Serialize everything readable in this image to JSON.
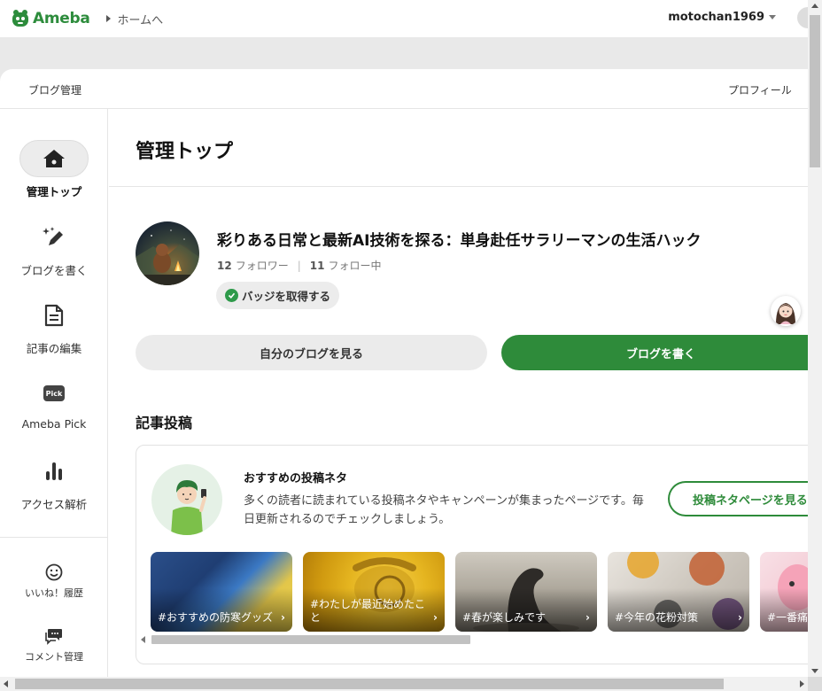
{
  "header": {
    "logo_text": "Ameba",
    "home_link": "ホームへ",
    "username": "motochan1969"
  },
  "subnav": {
    "left": "ブログ管理",
    "right": "プロフィール"
  },
  "sidebar": {
    "items": [
      {
        "label": "管理トップ",
        "icon": "home-icon"
      },
      {
        "label": "ブログを書く",
        "icon": "pen-sparkle-icon"
      },
      {
        "label": "記事の編集",
        "icon": "document-icon"
      },
      {
        "label": "Ameba Pick",
        "icon": "pick-icon",
        "icon_text": "Pick"
      },
      {
        "label": "アクセス解析",
        "icon": "bar-chart-icon"
      },
      {
        "label": "いいね！履歴",
        "icon": "smile-icon"
      },
      {
        "label": "コメント管理",
        "icon": "comment-icon"
      }
    ]
  },
  "main": {
    "page_title": "管理トップ",
    "blog_title": "彩りある日常と最新AI技術を探る：単身赴任サラリーマンの生活ハック",
    "followers_count": "12",
    "followers_label": "フォロワー",
    "following_count": "11",
    "following_label": "フォロー中",
    "badge_label": "バッジを取得する",
    "view_blog_button": "自分のブログを見る",
    "write_blog_button": "ブログを書く",
    "section_title": "記事投稿",
    "card": {
      "heading": "おすすめの投稿ネタ",
      "description": "多くの読者に読まれている投稿ネタやキャンペーンが集まったページです。毎日更新されるのでチェックしましょう。",
      "button": "投稿ネタページを見る"
    },
    "tiles": [
      {
        "label": "#おすすめの防寒グッズ"
      },
      {
        "label": "#わたしが最近始めたこと"
      },
      {
        "label": "#春が楽しみです"
      },
      {
        "label": "#今年の花粉対策"
      },
      {
        "label": "#一番痛"
      }
    ]
  },
  "colors": {
    "brand_green": "#2e8b3a",
    "badge_green": "#2e9a4a"
  }
}
